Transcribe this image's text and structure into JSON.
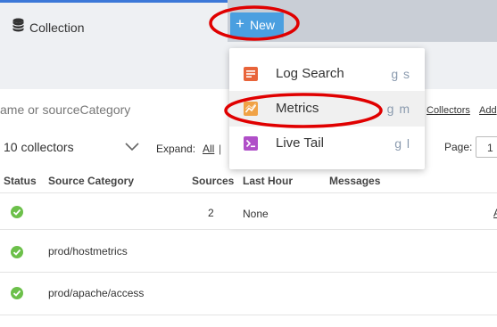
{
  "tabs": {
    "active_label": "Collection",
    "new_button_label": "New",
    "new_button_symbol": "+"
  },
  "filter": {
    "search_placeholder_fragment": "ame or sourceCategory",
    "link_collectors": "Collectors",
    "link_add": "Add"
  },
  "controls": {
    "collectors_select": "10 collectors",
    "expand_label": "Expand:",
    "expand_all": "All",
    "separator": "|",
    "page_label": "Page:",
    "page_value": "1"
  },
  "table": {
    "headers": [
      "Status",
      "Source Category",
      "Sources",
      "Last Hour",
      "Messages"
    ],
    "rows": [
      {
        "status": "ok",
        "source_category": "",
        "sources": "2",
        "last_hour": "None",
        "link": "A"
      },
      {
        "status": "ok",
        "source_category": "prod/hostmetrics",
        "sources": "",
        "last_hour": "",
        "link": ""
      },
      {
        "status": "ok",
        "source_category": "prod/apache/access",
        "sources": "",
        "last_hour": "",
        "link": ""
      }
    ]
  },
  "menu": {
    "items": [
      {
        "label": "Log Search",
        "shortcut": "g s",
        "icon": "log-search-icon",
        "color": "#e8643a"
      },
      {
        "label": "Metrics",
        "shortcut": "g m",
        "icon": "metrics-icon",
        "color": "#f0a246"
      },
      {
        "label": "Live Tail",
        "shortcut": "g l",
        "icon": "live-tail-icon",
        "color": "#b04fc8"
      }
    ]
  },
  "colors": {
    "accent_blue": "#4a9fe0",
    "tab_border": "#3c78d8",
    "status_green": "#6cc04a",
    "annotation_red": "#e00000"
  }
}
